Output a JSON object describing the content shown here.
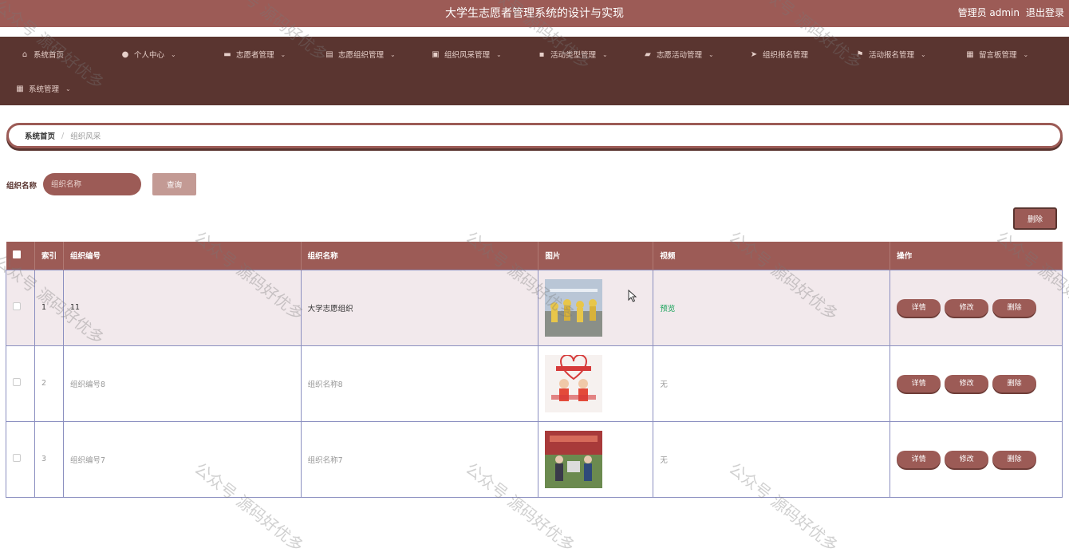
{
  "header": {
    "title": "大学生志愿者管理系统的设计与实现",
    "admin_label": "管理员 admin",
    "logout_label": "退出登录"
  },
  "nav": {
    "items": [
      {
        "label": "系统首页",
        "icon": "home-icon"
      },
      {
        "label": "个人中心",
        "icon": "user-icon"
      },
      {
        "label": "志愿者管理",
        "icon": "ticket-icon"
      },
      {
        "label": "志愿组织管理",
        "icon": "clipboard-icon"
      },
      {
        "label": "组织风采管理",
        "icon": "chart-icon"
      },
      {
        "label": "活动类型管理",
        "icon": "chat-icon"
      },
      {
        "label": "志愿活动管理",
        "icon": "briefcase-icon"
      },
      {
        "label": "组织报名管理",
        "icon": "send-icon"
      },
      {
        "label": "活动报名管理",
        "icon": "flag-icon"
      },
      {
        "label": "留言板管理",
        "icon": "grid-icon"
      },
      {
        "label": "系统管理",
        "icon": "grid-icon"
      }
    ]
  },
  "breadcrumb": {
    "home": "系统首页",
    "separator": "/",
    "current": "组织风采"
  },
  "search": {
    "label": "组织名称",
    "placeholder": "组织名称",
    "button": "查询"
  },
  "toolbar": {
    "delete_label": "删除"
  },
  "table": {
    "headers": {
      "index": "索引",
      "code": "组织编号",
      "name": "组织名称",
      "image": "图片",
      "video": "视频",
      "ops": "操作"
    },
    "rows": [
      {
        "index": "1",
        "code": "11",
        "name": "大学志愿组织",
        "video": "预览"
      },
      {
        "index": "2",
        "code": "组织编号8",
        "name": "组织名称8",
        "video": "无"
      },
      {
        "index": "3",
        "code": "组织编号7",
        "name": "组织名称7",
        "video": "无"
      }
    ],
    "ops": {
      "detail": "详情",
      "edit": "修改",
      "delete": "删除"
    }
  },
  "watermark": "公众号 源码好优多",
  "colors": {
    "primary": "#9c5b56",
    "nav_bg": "#5a3530",
    "selected_row": "#f2e9ec",
    "link_green": "#1aa35b"
  }
}
